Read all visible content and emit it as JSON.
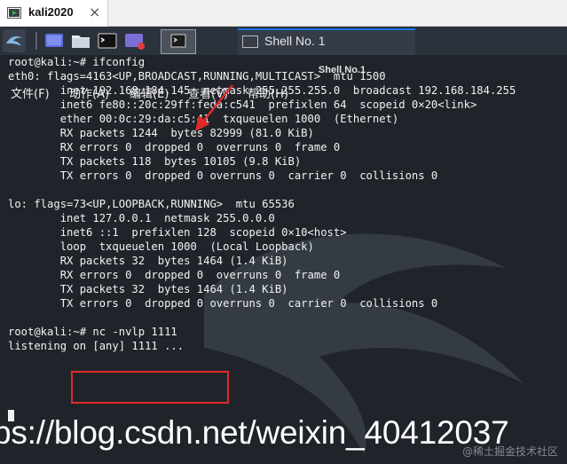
{
  "vm_tab": {
    "label": "kali2020",
    "close_symbol": "×"
  },
  "taskbar": {
    "launchers": [
      "workspace-icon",
      "file-manager-icon",
      "terminal-icon",
      "screen-recorder-icon"
    ],
    "active_task": {
      "label": "Shell No. 1"
    }
  },
  "terminal": {
    "title": "Shell No.1",
    "menu": [
      "文件(F)",
      "动作(A)",
      "编辑(E)",
      "查看(V)",
      "帮助(H)"
    ],
    "lines": [
      "root@kali:~# ifconfig",
      "eth0: flags=4163<UP,BROADCAST,RUNNING,MULTICAST>  mtu 1500",
      "        inet 192.168.184.145  netmask 255.255.255.0  broadcast 192.168.184.255",
      "        inet6 fe80::20c:29ff:feda:c541  prefixlen 64  scopeid 0×20<link>",
      "        ether 00:0c:29:da:c5:41  txqueuelen 1000  (Ethernet)",
      "        RX packets 1244  bytes 82999 (81.0 KiB)",
      "        RX errors 0  dropped 0  overruns 0  frame 0",
      "        TX packets 118  bytes 10105 (9.8 KiB)",
      "        TX errors 0  dropped 0 overruns 0  carrier 0  collisions 0",
      "",
      "lo: flags=73<UP,LOOPBACK,RUNNING>  mtu 65536",
      "        inet 127.0.0.1  netmask 255.0.0.0",
      "        inet6 ::1  prefixlen 128  scopeid 0×10<host>",
      "        loop  txqueuelen 1000  (Local Loopback)",
      "        RX packets 32  bytes 1464 (1.4 KiB)",
      "        RX errors 0  dropped 0  overruns 0  frame 0",
      "        TX packets 32  bytes 1464 (1.4 KiB)",
      "        TX errors 0  dropped 0 overruns 0  carrier 0  collisions 0",
      "",
      "root@kali:~# nc -nvlp 1111",
      "listening on [any] 1111 ..."
    ]
  },
  "watermark": {
    "url": "ps://blog.csdn.net/weixin_40412037",
    "platform": "@稀土掘金技术社区"
  },
  "colors": {
    "terminal_bg": "#20242a",
    "panel_bg": "#2c323c",
    "annotation": "#e02a2a",
    "active_tab_accent": "#1a73e8"
  }
}
